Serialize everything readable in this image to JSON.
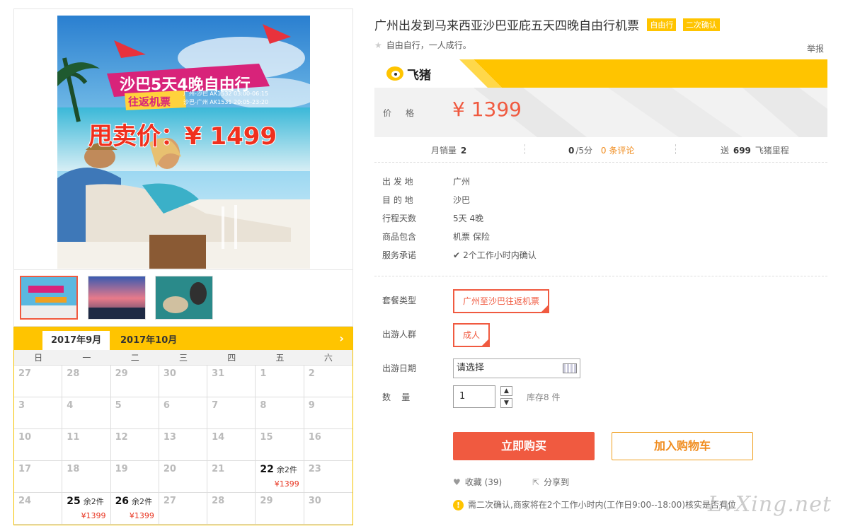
{
  "banner": {
    "headline": "沙巴5天4晚自由行",
    "subline": "往返机票",
    "flight1": "广州-沙巴 AK1532  03:00-06:15",
    "flight2": "沙巴-广州 AK1531  20:05-23:20",
    "promo": "甩卖价：¥ 1499"
  },
  "calendar": {
    "months": [
      "2017年9月",
      "2017年10月"
    ],
    "weekdays": [
      "日",
      "一",
      "二",
      "三",
      "四",
      "五",
      "六"
    ],
    "days": [
      {
        "d": "27"
      },
      {
        "d": "28"
      },
      {
        "d": "29"
      },
      {
        "d": "30"
      },
      {
        "d": "31"
      },
      {
        "d": "1"
      },
      {
        "d": "2"
      },
      {
        "d": "3"
      },
      {
        "d": "4"
      },
      {
        "d": "5"
      },
      {
        "d": "6"
      },
      {
        "d": "7"
      },
      {
        "d": "8"
      },
      {
        "d": "9"
      },
      {
        "d": "10"
      },
      {
        "d": "11"
      },
      {
        "d": "12"
      },
      {
        "d": "13"
      },
      {
        "d": "14"
      },
      {
        "d": "15"
      },
      {
        "d": "16"
      },
      {
        "d": "17"
      },
      {
        "d": "18"
      },
      {
        "d": "19"
      },
      {
        "d": "20"
      },
      {
        "d": "21"
      },
      {
        "d": "22",
        "stock": "余2件",
        "price": "¥1399"
      },
      {
        "d": "23"
      },
      {
        "d": "24"
      },
      {
        "d": "25",
        "stock": "余2件",
        "price": "¥1399"
      },
      {
        "d": "26",
        "stock": "余2件",
        "price": "¥1399"
      },
      {
        "d": "27"
      },
      {
        "d": "28"
      },
      {
        "d": "29"
      },
      {
        "d": "30"
      }
    ]
  },
  "product": {
    "title": "广州出发到马来西亚沙巴亚庇五天四晚自由行机票",
    "tags": [
      "自由行",
      "二次确认"
    ],
    "subtitle": "自由自行，一人成行。",
    "report": "举报"
  },
  "price_panel": {
    "brand": "飞猪",
    "price_label": "价格",
    "price": "¥ 1399"
  },
  "stats": {
    "monthly_sales_label": "月销量",
    "monthly_sales": "2",
    "rating": "0",
    "rating_suffix": "/5分",
    "reviews": "0 条评论",
    "miles_prefix": "送",
    "miles": "699",
    "miles_suffix": "飞猪里程"
  },
  "info": [
    {
      "label": "出 发 地",
      "value": "广州"
    },
    {
      "label": "目 的 地",
      "value": "沙巴"
    },
    {
      "label": "行程天数",
      "value": "5天 4晚"
    },
    {
      "label": "商品包含",
      "value": "机票  保险"
    },
    {
      "label": "服务承诺",
      "value": "2个工作小时内确认"
    }
  ],
  "options": {
    "package_label": "套餐类型",
    "package_value": "广州至沙巴往返机票",
    "traveler_label": "出游人群",
    "traveler_value": "成人",
    "date_label": "出游日期",
    "date_placeholder": "请选择",
    "qty_label": "数    量",
    "qty_value": "1",
    "stock": "库存8 件"
  },
  "actions": {
    "buy": "立即购买",
    "cart": "加入购物车",
    "favorite": "收藏 (39)",
    "share": "分享到",
    "notice": "需二次确认,商家将在2个工作小时内(工作日9:00--18:00)核实是否有位"
  },
  "watermark": "LvXing.net",
  "colors": {
    "accent": "#f05a40",
    "brand_yellow": "#ffc400"
  }
}
